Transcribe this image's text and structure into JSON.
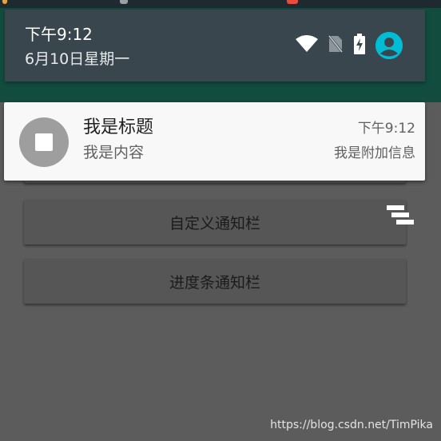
{
  "status_bar": {
    "dot_colors": [
      "#e8a534",
      "#e8a534",
      "#e74c3c"
    ]
  },
  "quick_settings": {
    "time": "下午9:12",
    "date": "6月10日星期一",
    "icons": [
      "wifi-icon",
      "no-sim-icon",
      "battery-charging-icon",
      "account-icon"
    ],
    "accent_color": "#00bcd4"
  },
  "notification": {
    "title": "我是标题",
    "content": "我是内容",
    "time": "下午9:12",
    "sub_info": "我是附加信息",
    "icon": "stop-icon"
  },
  "app": {
    "buttons": [
      {
        "label": ""
      },
      {
        "label": "自定义通知栏"
      },
      {
        "label": "进度条通知栏"
      }
    ],
    "handle_icon": "overflow-handle-icon"
  },
  "watermark": "https://blog.csdn.net/TimPika"
}
